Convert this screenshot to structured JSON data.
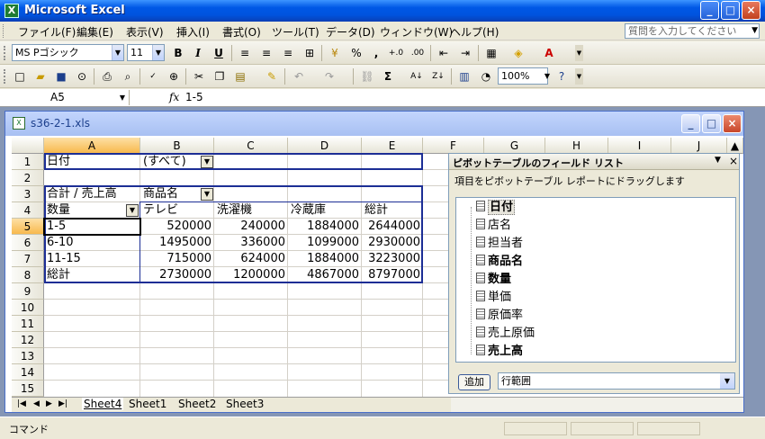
{
  "app": {
    "title": "Microsoft Excel"
  },
  "menu": [
    "ファイル(F)",
    "編集(E)",
    "表示(V)",
    "挿入(I)",
    "書式(O)",
    "ツール(T)",
    "データ(D)",
    "ウィンドウ(W)",
    "ヘルプ(H)"
  ],
  "help": {
    "placeholder": "質問を入力してください"
  },
  "format_toolbar": {
    "font_name": "MS Pゴシック",
    "font_size": "11",
    "bold": "B",
    "italic": "I",
    "underline": "U",
    "percent": "%",
    "comma": ","
  },
  "standard_toolbar": {
    "zoom": "100%"
  },
  "formula_bar": {
    "cell_ref": "A5",
    "fx": "fx",
    "content": "1-5"
  },
  "document": {
    "title": "s36-2-1.xls"
  },
  "grid": {
    "columns": [
      "A",
      "B",
      "C",
      "D",
      "E",
      "F",
      "G",
      "H",
      "I",
      "J"
    ],
    "rows": [
      "1",
      "2",
      "3",
      "4",
      "5",
      "6",
      "7",
      "8",
      "9",
      "10",
      "11",
      "12",
      "13",
      "14",
      "15"
    ]
  },
  "pivot": {
    "page_field": {
      "label": "日付",
      "value": "(すべて)"
    },
    "data_label": "合計 / 売上高",
    "col_field": "商品名",
    "row_field": "数量",
    "headers": [
      "テレビ",
      "洗濯機",
      "冷蔵庫",
      "総計"
    ],
    "rows": [
      {
        "label": "1-5",
        "values": [
          "520000",
          "240000",
          "1884000",
          "2644000"
        ]
      },
      {
        "label": "6-10",
        "values": [
          "1495000",
          "336000",
          "1099000",
          "2930000"
        ]
      },
      {
        "label": "11-15",
        "values": [
          "715000",
          "624000",
          "1884000",
          "3223000"
        ]
      },
      {
        "label": "総計",
        "values": [
          "2730000",
          "1200000",
          "4867000",
          "8797000"
        ]
      }
    ]
  },
  "field_list": {
    "title": "ピボットテーブルのフィールド リスト",
    "instructions": "項目をピボットテーブル レポートにドラッグします",
    "fields": [
      {
        "name": "日付",
        "bold": true,
        "selected": true
      },
      {
        "name": "店名",
        "bold": false,
        "selected": false
      },
      {
        "name": "担当者",
        "bold": false,
        "selected": false
      },
      {
        "name": "商品名",
        "bold": true,
        "selected": false
      },
      {
        "name": "数量",
        "bold": true,
        "selected": false
      },
      {
        "name": "単価",
        "bold": false,
        "selected": false
      },
      {
        "name": "原価率",
        "bold": false,
        "selected": false
      },
      {
        "name": "売上原価",
        "bold": false,
        "selected": false
      },
      {
        "name": "売上高",
        "bold": true,
        "selected": false
      }
    ],
    "add_button": "追加",
    "area": "行範囲"
  },
  "sheets": [
    "Sheet4",
    "Sheet1",
    "Sheet2",
    "Sheet3"
  ],
  "status": {
    "text": "コマンド"
  }
}
